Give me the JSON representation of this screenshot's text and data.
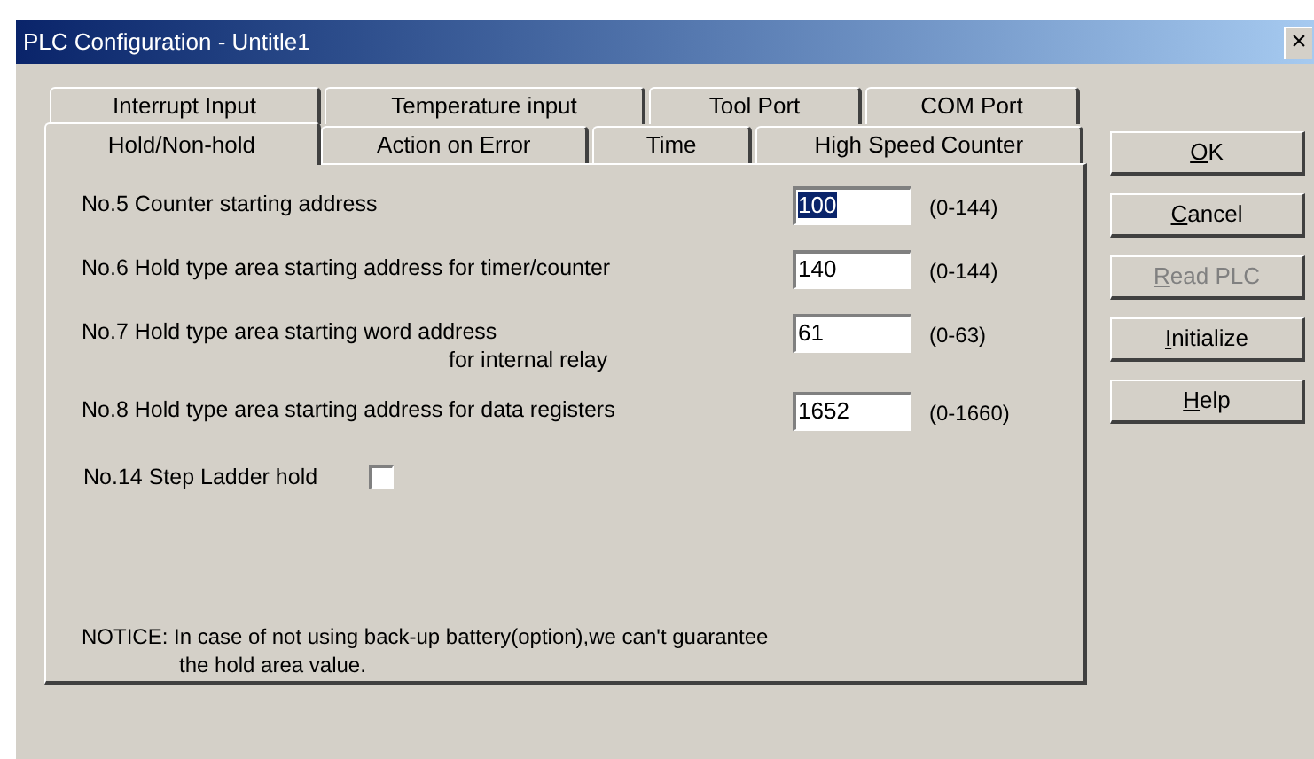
{
  "window": {
    "title": "PLC Configuration - Untitle1",
    "close": "×"
  },
  "tab_rows": [
    [
      {
        "label": "Interrupt Input",
        "selected": false
      },
      {
        "label": "Temperature input",
        "selected": false
      },
      {
        "label": "Tool Port",
        "selected": false
      },
      {
        "label": "COM Port",
        "selected": false
      }
    ],
    [
      {
        "label": "Hold/Non-hold",
        "selected": true
      },
      {
        "label": "Action on Error",
        "selected": false
      },
      {
        "label": "Time",
        "selected": false
      },
      {
        "label": "High Speed Counter",
        "selected": false
      }
    ]
  ],
  "fields": [
    {
      "kind": "text",
      "label": "No.5 Counter starting address",
      "value": "100",
      "selected": true,
      "range": "(0-144)"
    },
    {
      "kind": "text",
      "label": "No.6 Hold type area starting address for timer/counter",
      "value": "140",
      "selected": false,
      "range": "(0-144)"
    },
    {
      "kind": "text",
      "label": "No.7 Hold type area starting word address",
      "label_line2": "for internal relay",
      "value": "61",
      "selected": false,
      "range": "(0-63)"
    },
    {
      "kind": "text",
      "label": "No.8 Hold type area starting address for data registers",
      "value": "1652",
      "selected": false,
      "range": "(0-1660)"
    },
    {
      "kind": "checkbox",
      "label": "No.14 Step Ladder hold",
      "checked": false
    }
  ],
  "notice": {
    "line1": "NOTICE: In case of not using back-up battery(option),we can't guarantee",
    "line2": "the hold area value."
  },
  "buttons": [
    {
      "label": "OK",
      "disabled": false,
      "mnemonic": true
    },
    {
      "label": "Cancel",
      "disabled": false,
      "mnemonic": true
    },
    {
      "label": "Read PLC",
      "disabled": true,
      "mnemonic": true
    },
    {
      "label": "Initialize",
      "disabled": false,
      "mnemonic": true
    },
    {
      "label": "Help",
      "disabled": false,
      "mnemonic": true
    }
  ]
}
